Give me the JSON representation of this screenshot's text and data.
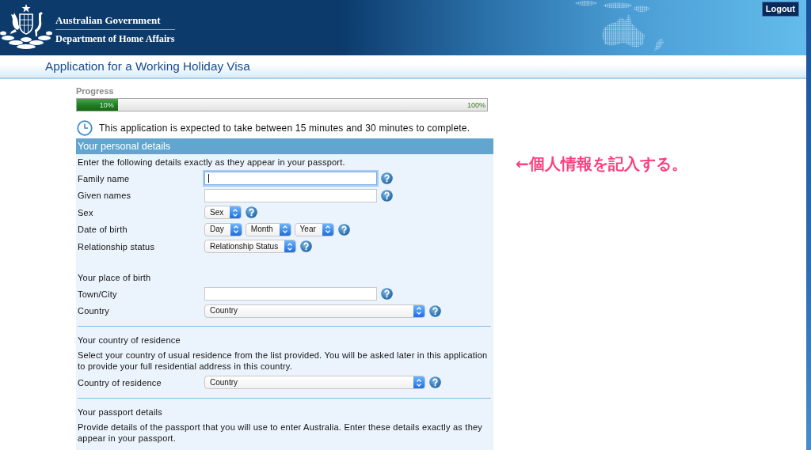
{
  "header": {
    "line1": "Australian Government",
    "line2": "Department of Home Affairs",
    "logout": "Logout"
  },
  "page_title": "Application for a Working Holiday Visa",
  "progress": {
    "label": "Progress",
    "level": 0.1,
    "value_label": "10%",
    "end_label": "100%"
  },
  "duration_note": "This application is expected to take between 15 minutes and 30 minutes to complete.",
  "personal": {
    "title": "Your personal details",
    "intro": "Enter the following details exactly as they appear in your passport.",
    "fields": [
      {
        "label": "Family name",
        "kind": "text",
        "focused": true
      },
      {
        "label": "Given names",
        "kind": "text",
        "focused": false
      },
      {
        "label": "Sex",
        "kind": "select",
        "value": "Sex",
        "focused": false
      },
      {
        "label": "Date of birth",
        "kind": "date",
        "parts": [
          "Day",
          "Month",
          "Year"
        ],
        "focused": false
      },
      {
        "label": "Relationship status",
        "kind": "select",
        "value": "Relationship Status",
        "focused": false
      }
    ],
    "subsections": [
      {
        "heading": "Your place of birth",
        "fields": [
          {
            "label": "Town/City",
            "kind": "text",
            "focused": false
          },
          {
            "label": "Country",
            "kind": "wideselect",
            "value": "Country",
            "focused": false
          }
        ]
      }
    ]
  },
  "sections": [
    {
      "heading": "Your country of residence",
      "text": "Select your country of usual residence from the list provided. You will be asked later in this application to provide your full residential address in this country.",
      "fields": [
        {
          "label": "Country of residence",
          "kind": "wideselect",
          "value": "Country",
          "focused": false
        }
      ]
    },
    {
      "heading": "Your passport details",
      "text": "Provide details of the passport that you will use to enter Australia. Enter these details exactly as they appear in your passport."
    }
  ],
  "annotation": "←個人情報を記入する。"
}
